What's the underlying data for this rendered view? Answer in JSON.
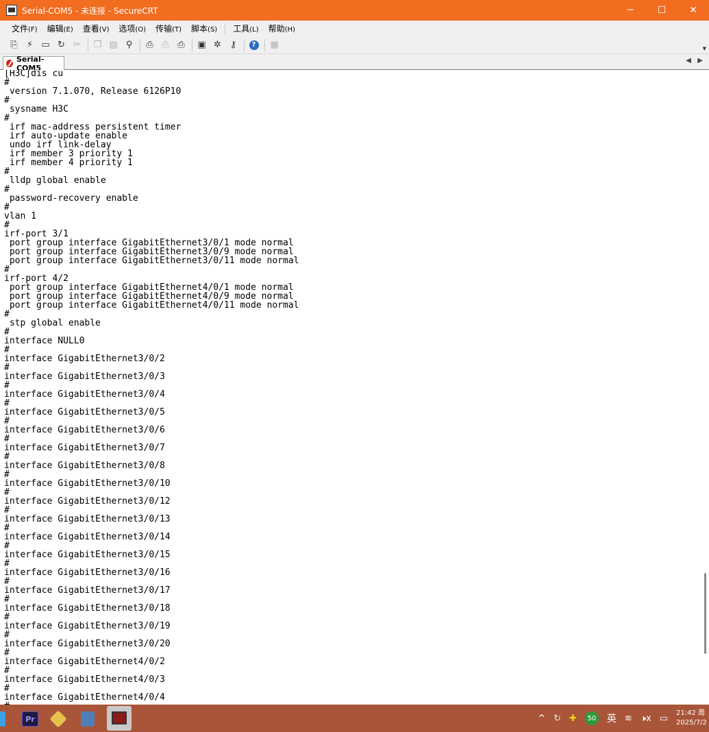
{
  "window": {
    "title": "Serial-COM5 - 未连接 - SecureCRT",
    "minimize_glyph": "─",
    "maximize_glyph": "☐",
    "close_glyph": "✕"
  },
  "menubar": {
    "items": [
      {
        "label": "文件",
        "accel": "(F)"
      },
      {
        "label": "编辑",
        "accel": "(E)"
      },
      {
        "label": "查看",
        "accel": "(V)"
      },
      {
        "label": "选项",
        "accel": "(O)"
      },
      {
        "label": "传输",
        "accel": "(T)"
      },
      {
        "label": "脚本",
        "accel": "(S)"
      },
      {
        "label": "工具",
        "accel": "(L)"
      },
      {
        "label": "帮助",
        "accel": "(H)"
      }
    ]
  },
  "toolbar": {
    "icons": [
      "connect-icon",
      "quick-connect-icon",
      "connect-tab-icon",
      "reconnect-icon",
      "disconnect-icon",
      "copy-icon",
      "paste-icon",
      "find-icon",
      "print-icon",
      "print-selection-icon",
      "print-setup-icon",
      "session-options-icon",
      "global-options-icon",
      "keymap-icon",
      "help-icon",
      "log-icon"
    ],
    "help_glyph": "?"
  },
  "tabs": {
    "active_label": "Serial-COM5",
    "nav_left": "◀",
    "nav_right": "▶"
  },
  "terminal": {
    "lines": [
      "[H3C]dis cu",
      "#",
      " version 7.1.070, Release 6126P10",
      "#",
      " sysname H3C",
      "#",
      " irf mac-address persistent timer",
      " irf auto-update enable",
      " undo irf link-delay",
      " irf member 3 priority 1",
      " irf member 4 priority 1",
      "#",
      " lldp global enable",
      "#",
      " password-recovery enable",
      "#",
      "vlan 1",
      "#",
      "irf-port 3/1",
      " port group interface GigabitEthernet3/0/1 mode normal",
      " port group interface GigabitEthernet3/0/9 mode normal",
      " port group interface GigabitEthernet3/0/11 mode normal",
      "#",
      "irf-port 4/2",
      " port group interface GigabitEthernet4/0/1 mode normal",
      " port group interface GigabitEthernet4/0/9 mode normal",
      " port group interface GigabitEthernet4/0/11 mode normal",
      "#",
      " stp global enable",
      "#",
      "interface NULL0",
      "#",
      "interface GigabitEthernet3/0/2",
      "#",
      "interface GigabitEthernet3/0/3",
      "#",
      "interface GigabitEthernet3/0/4",
      "#",
      "interface GigabitEthernet3/0/5",
      "#",
      "interface GigabitEthernet3/0/6",
      "#",
      "interface GigabitEthernet3/0/7",
      "#",
      "interface GigabitEthernet3/0/8",
      "#",
      "interface GigabitEthernet3/0/10",
      "#",
      "interface GigabitEthernet3/0/12",
      "#",
      "interface GigabitEthernet3/0/13",
      "#",
      "interface GigabitEthernet3/0/14",
      "#",
      "interface GigabitEthernet3/0/15",
      "#",
      "interface GigabitEthernet3/0/16",
      "#",
      "interface GigabitEthernet3/0/17",
      "#",
      "interface GigabitEthernet3/0/18",
      "#",
      "interface GigabitEthernet3/0/19",
      "#",
      "interface GigabitEthernet3/0/20",
      "#",
      "interface GigabitEthernet4/0/2",
      "#",
      "interface GigabitEthernet4/0/3",
      "#",
      "interface GigabitEthernet4/0/4",
      "#"
    ]
  },
  "taskbar": {
    "premiere_label": "Pr",
    "tray_badge": "50",
    "input_language": "英",
    "chevron_glyph": "^",
    "wifi_glyph": "≋",
    "volume_glyph": "🕨x",
    "battery_glyph": "▭",
    "clock_time": "21:42 周",
    "clock_date": "2025/7/2"
  }
}
